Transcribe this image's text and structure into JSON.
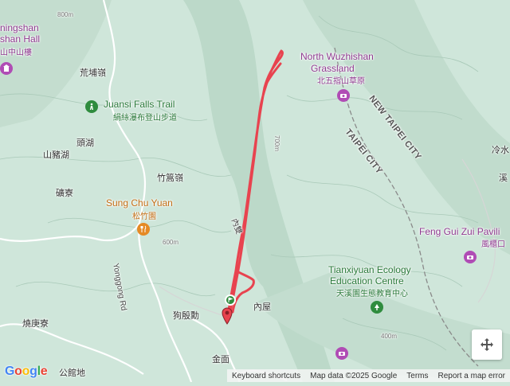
{
  "map": {
    "colors": {
      "terrain": "#cfe6da",
      "ridge": "#b9d8c8",
      "road": "#ffffff",
      "track": "#e8434f",
      "boundary": "#8a8a8a"
    },
    "labels": {
      "yangmingshan_en_1": "ningshan",
      "yangmingshan_en_2": "shan Hall",
      "yangmingshan_zh": "山中山樓",
      "huangpu_ridge": "荒埔嶺",
      "juansi_falls_en": "Juansi Falls Trail",
      "juansi_falls_zh": "絹絲瀑布登山步道",
      "touhu": "頭湖",
      "shanzhuhu": "山豬湖",
      "zhugao_ridge": "竹篙嶺",
      "kuangliao": "礦寮",
      "sung_chu_yuan_en": "Sung Chu Yuan",
      "sung_chu_yuan_zh": "松竹園",
      "yonggong_rd": "Yonggong Rd",
      "goudianxun": "狗殷勳",
      "neiwu": "內屋",
      "raogengliao": "燒庚寮",
      "gongguandi": "公館地",
      "jinmian": "金面",
      "north_wuzhishan_en_1": "North Wuzhishan",
      "north_wuzhishan_en_2": "Grassland",
      "north_wuzhishan_zh": "北五指山草原",
      "new_taipei_city": "NEW TAIPEI CITY",
      "taipei_city": "TAIPEI CITY",
      "lengshui": "冷水",
      "xi": "溪",
      "feng_gui_zui_en": "Feng Gui Zui Pavili",
      "feng_gui_zui_zh": "風櫃口",
      "tianxiyuan_en_1": "Tianxiyuan Ecology",
      "tianxiyuan_en_2": "Education Centre",
      "tianxiyuan_zh": "天溪園生態教育中心",
      "contour_800": "800m",
      "contour_700": "700m",
      "contour_600": "600m",
      "contour_400": "400m",
      "road_neiyi": "內雙"
    },
    "icons": {
      "yangmingshan": "building-icon",
      "juansi_falls": "hiking-icon",
      "sung_chu_yuan": "restaurant-icon",
      "north_wuzhishan": "camera-icon",
      "feng_gui_zui": "camera-icon",
      "tianxiyuan": "tree-icon",
      "bottom_poi": "camera-icon",
      "start": "start-flag-icon",
      "end": "end-marker-icon"
    }
  },
  "footer": {
    "logo": "Google",
    "keyboard_shortcuts": "Keyboard shortcuts",
    "map_data": "Map data ©2025 Google",
    "terms": "Terms",
    "report": "Report a map error"
  }
}
